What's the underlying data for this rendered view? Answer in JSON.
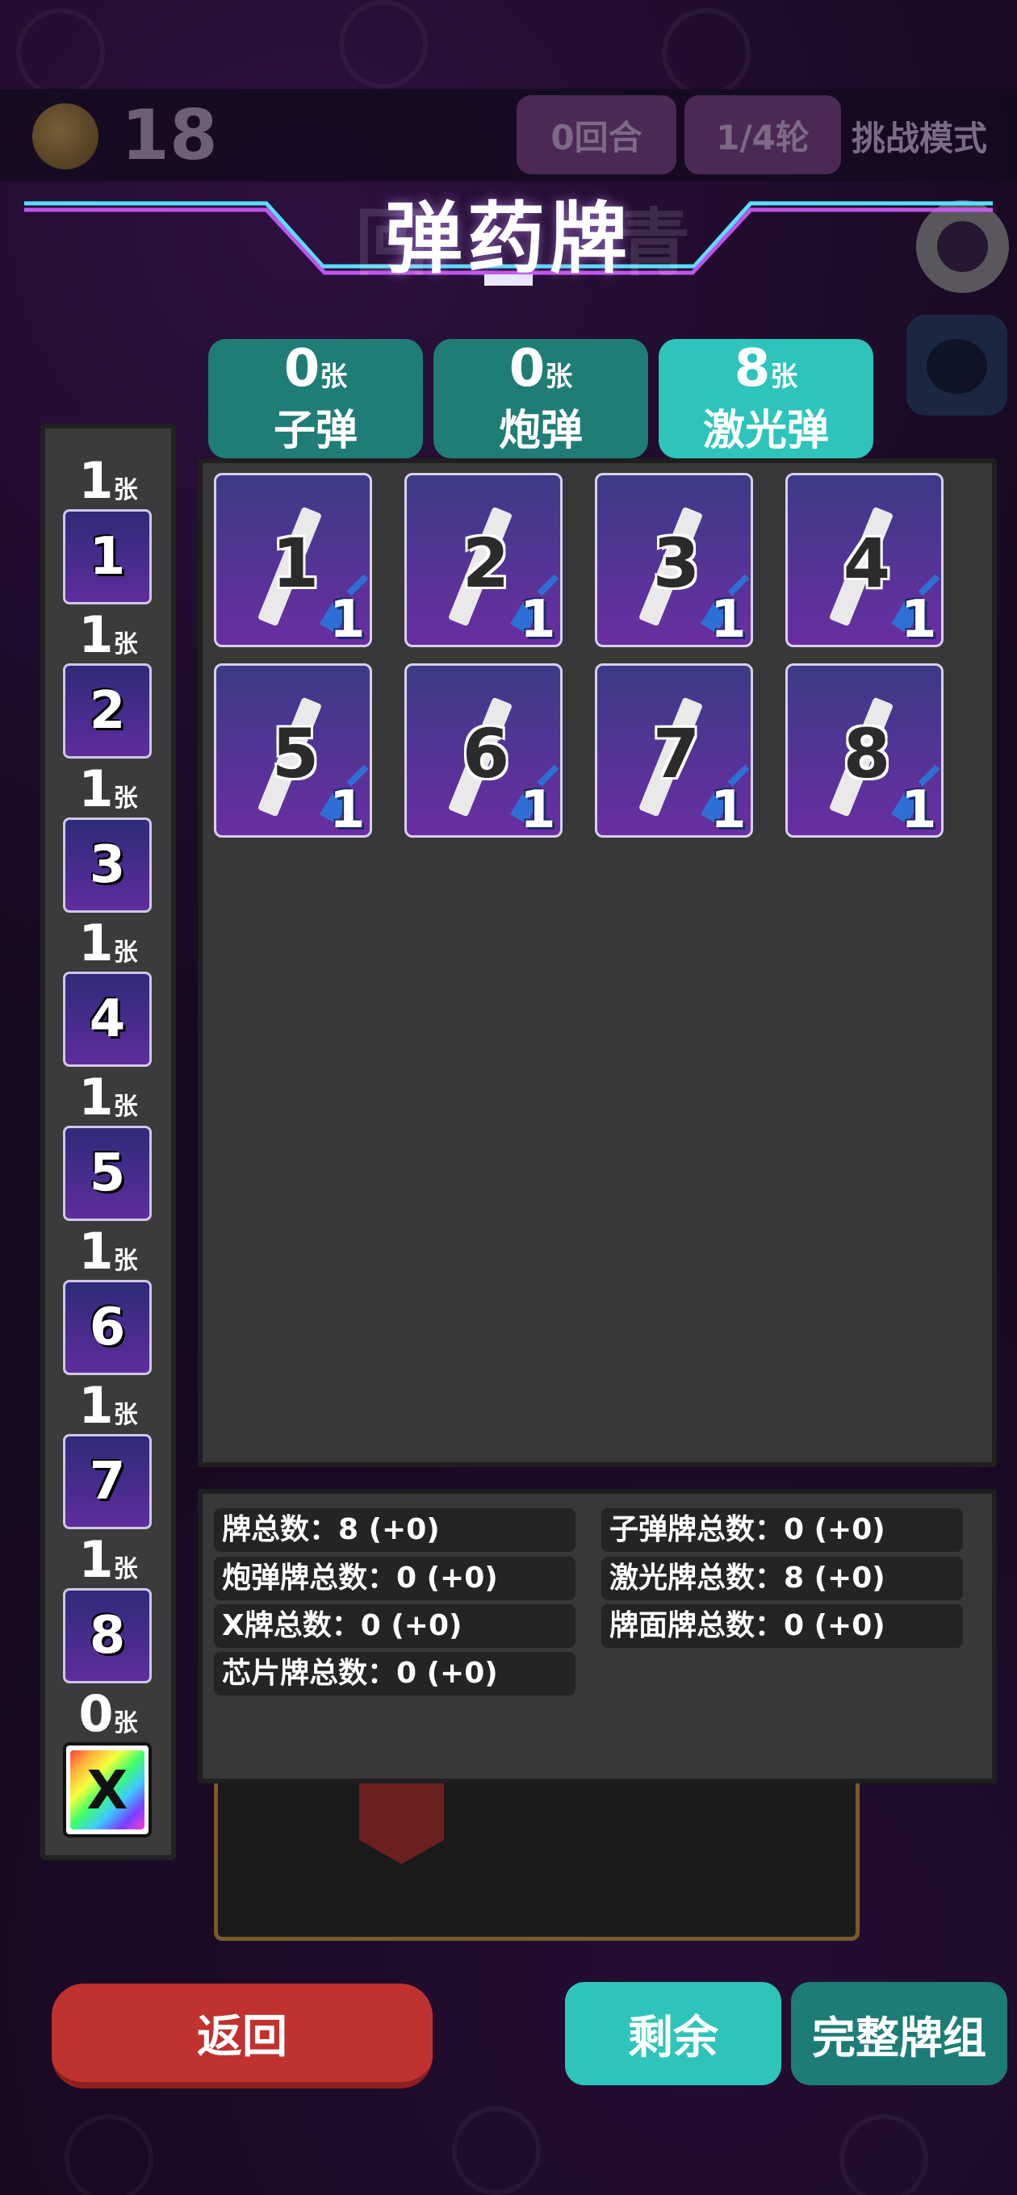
{
  "topbar": {
    "coins": "18",
    "round": "0回合",
    "wave": "1/4轮",
    "mode": "挑战模式"
  },
  "title": "弹药牌",
  "unit": "张",
  "ammo_types": [
    {
      "count": "0",
      "name": "子弹",
      "active": false
    },
    {
      "count": "0",
      "name": "炮弹",
      "active": false
    },
    {
      "count": "8",
      "name": "激光弹",
      "active": true
    }
  ],
  "sidebar": [
    {
      "count": "1",
      "label": "1"
    },
    {
      "count": "1",
      "label": "2"
    },
    {
      "count": "1",
      "label": "3"
    },
    {
      "count": "1",
      "label": "4"
    },
    {
      "count": "1",
      "label": "5"
    },
    {
      "count": "1",
      "label": "6"
    },
    {
      "count": "1",
      "label": "7"
    },
    {
      "count": "1",
      "label": "8"
    },
    {
      "count": "0",
      "label": "X"
    }
  ],
  "cards": [
    {
      "num": "1",
      "level": "1"
    },
    {
      "num": "2",
      "level": "1"
    },
    {
      "num": "3",
      "level": "1"
    },
    {
      "num": "4",
      "level": "1"
    },
    {
      "num": "5",
      "level": "1"
    },
    {
      "num": "6",
      "level": "1"
    },
    {
      "num": "7",
      "level": "1"
    },
    {
      "num": "8",
      "level": "1"
    }
  ],
  "stats": [
    "牌总数：8 (+0)",
    "子弹牌总数：0 (+0)",
    "炮弹牌总数：0 (+0)",
    "激光牌总数：8 (+0)",
    "X牌总数：0 (+0)",
    "牌面牌总数：0 (+0)",
    "芯片牌总数：0 (+0)"
  ],
  "buttons": {
    "back": "返回",
    "remaining": "剩余",
    "full_deck": "完整牌组"
  }
}
